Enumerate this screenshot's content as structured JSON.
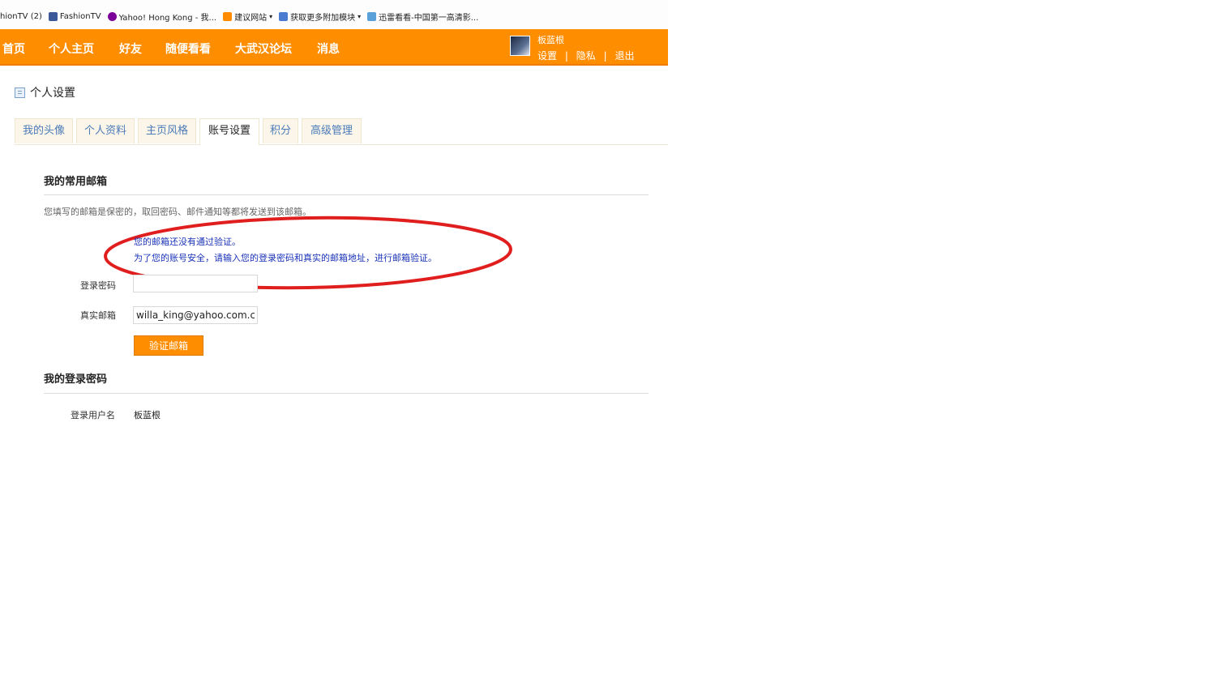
{
  "bookmarks": [
    {
      "label": "hionTV (2)",
      "icon": "generic-page-icon"
    },
    {
      "label": "FashionTV",
      "icon": "facebook-icon"
    },
    {
      "label": "Yahoo! Hong Kong - 我...",
      "icon": "yahoo-icon"
    },
    {
      "label": "建议网站",
      "icon": "suggested-sites-icon"
    },
    {
      "label": "获取更多附加模块",
      "icon": "ie-addons-icon"
    },
    {
      "label": "迅雷看看-中国第一高清影...",
      "icon": "ie-page-icon"
    }
  ],
  "nav": {
    "items": [
      "首页",
      "个人主页",
      "好友",
      "随便看看",
      "大武汉论坛",
      "消息"
    ],
    "username": "板蓝根",
    "links": [
      "设置",
      "隐私",
      "退出"
    ],
    "separator": "|",
    "color": "#ff8d00"
  },
  "page": {
    "title": "个人设置",
    "tabs": [
      "我的头像",
      "个人资料",
      "主页风格",
      "账号设置",
      "积分",
      "高级管理"
    ],
    "active_tab": "账号设置"
  },
  "email_section": {
    "title": "我的常用邮箱",
    "description": "您填写的邮箱是保密的，取回密码、邮件通知等都将发送到该邮箱。",
    "notice_line1": "您的邮箱还没有通过验证。",
    "notice_line2": "为了您的账号安全，请输入您的登录密码和真实的邮箱地址，进行邮箱验证。",
    "password_label": "登录密码",
    "password_value": "",
    "email_label": "真实邮箱",
    "email_value": "willa_king@yahoo.com.c",
    "verify_button": "验证邮箱"
  },
  "password_section": {
    "title": "我的登录密码",
    "username_label": "登录用户名",
    "username_value": "板蓝根"
  }
}
